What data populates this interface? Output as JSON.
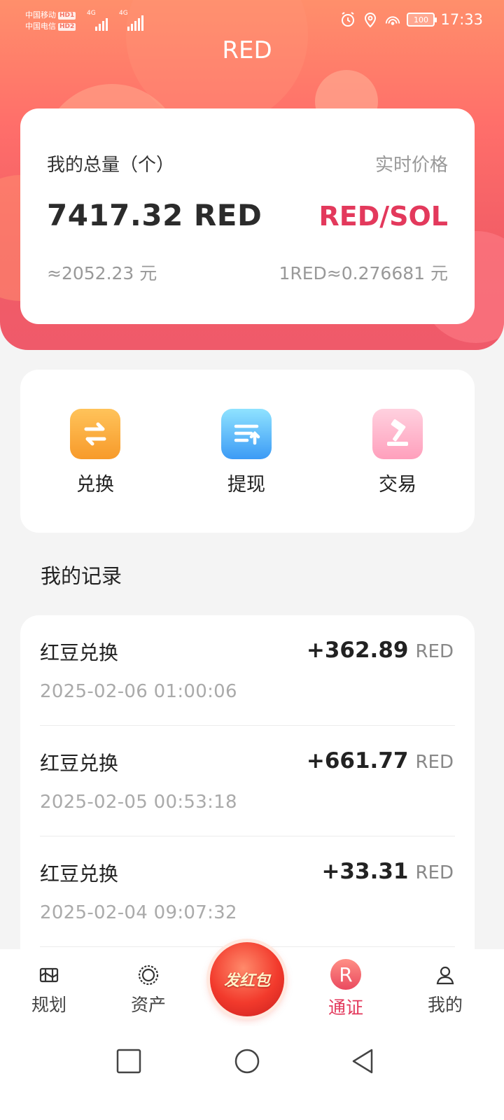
{
  "status_bar": {
    "carrier1": "中国移动",
    "carrier1_badge": "HD1",
    "carrier2": "中国电信",
    "carrier2_badge": "HD2",
    "network1": "4G",
    "network2": "4G",
    "battery": "100",
    "time": "17:33",
    "icons": [
      "alarm-icon",
      "location-icon",
      "hotspot-icon",
      "battery-icon"
    ]
  },
  "header": {
    "title": "RED"
  },
  "balance": {
    "total_label": "我的总量（个）",
    "price_label": "实时价格",
    "amount": "7417.32 RED",
    "pair": "RED/SOL",
    "approx_value": "≈2052.23 元",
    "unit_price": "1RED≈0.276681 元",
    "accent_color": "#e3395c"
  },
  "actions": [
    {
      "label": "兑换",
      "icon": "exchange-icon"
    },
    {
      "label": "提现",
      "icon": "withdraw-icon"
    },
    {
      "label": "交易",
      "icon": "auction-hammer-icon"
    }
  ],
  "records": {
    "title": "我的记录",
    "items": [
      {
        "name": "红豆兑换",
        "amount": "+362.89",
        "unit": "RED",
        "time": "2025-02-06 01:00:06"
      },
      {
        "name": "红豆兑换",
        "amount": "+661.77",
        "unit": "RED",
        "time": "2025-02-05 00:53:18"
      },
      {
        "name": "红豆兑换",
        "amount": "+33.31",
        "unit": "RED",
        "time": "2025-02-04 09:07:32"
      }
    ]
  },
  "bottom_nav": {
    "items": [
      {
        "label": "规划",
        "icon": "map-icon"
      },
      {
        "label": "资产",
        "icon": "assets-icon"
      },
      {
        "label": "通证",
        "icon": "token-r-icon",
        "badge": "R",
        "active": true
      },
      {
        "label": "我的",
        "icon": "person-icon"
      }
    ],
    "center_button": "发红包"
  }
}
